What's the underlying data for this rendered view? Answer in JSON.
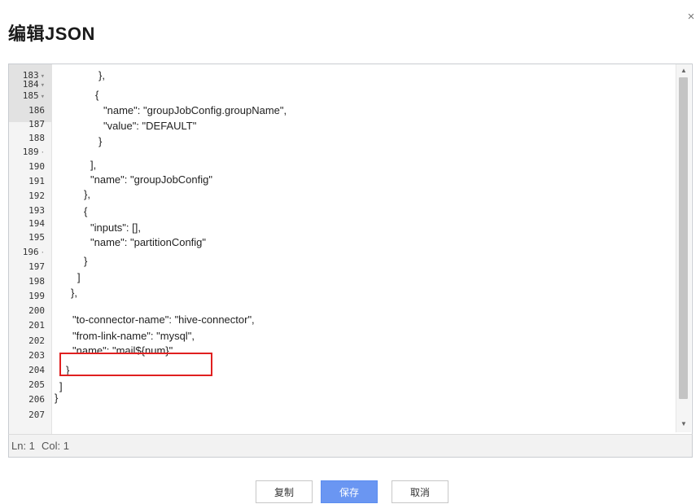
{
  "dialog": {
    "title": "编辑JSON",
    "close_glyph": "×"
  },
  "editor": {
    "line_numbers": [
      "183",
      "184",
      "185",
      "186",
      "187",
      "188",
      "189",
      "190",
      "191",
      "192",
      "193",
      "194",
      "195",
      "196",
      "197",
      "198",
      "199",
      "200",
      "201",
      "202",
      "203",
      "204",
      "205",
      "206",
      "207"
    ],
    "fold_markers": [
      "▾",
      "▾",
      "▾",
      "",
      "",
      "",
      "·",
      "",
      "",
      "",
      "",
      "",
      "",
      "·",
      "",
      "",
      "",
      "",
      "",
      "",
      "",
      "",
      "",
      "",
      ""
    ],
    "code_lines": [
      "},",
      "{",
      "\"name\": \"groupJobConfig.groupName\",",
      "\"value\": \"DEFAULT\"",
      "}",
      "],",
      "\"name\": \"groupJobConfig\"",
      "},",
      "{",
      "\"inputs\": [],",
      "\"name\": \"partitionConfig\"",
      "}",
      "]",
      "},",
      "\"to-connector-name\": \"hive-connector\",",
      "\"from-link-name\": \"mysql\",",
      "\"name\": \"mail${num}\"",
      "}",
      "]",
      "}"
    ]
  },
  "scrollbar": {
    "up_glyph": "▲",
    "down_glyph": "▼"
  },
  "statusbar": {
    "ln": "Ln: 1",
    "col": "Col: 1"
  },
  "buttons": {
    "copy": "复制",
    "save": "保存",
    "cancel": "取消"
  }
}
